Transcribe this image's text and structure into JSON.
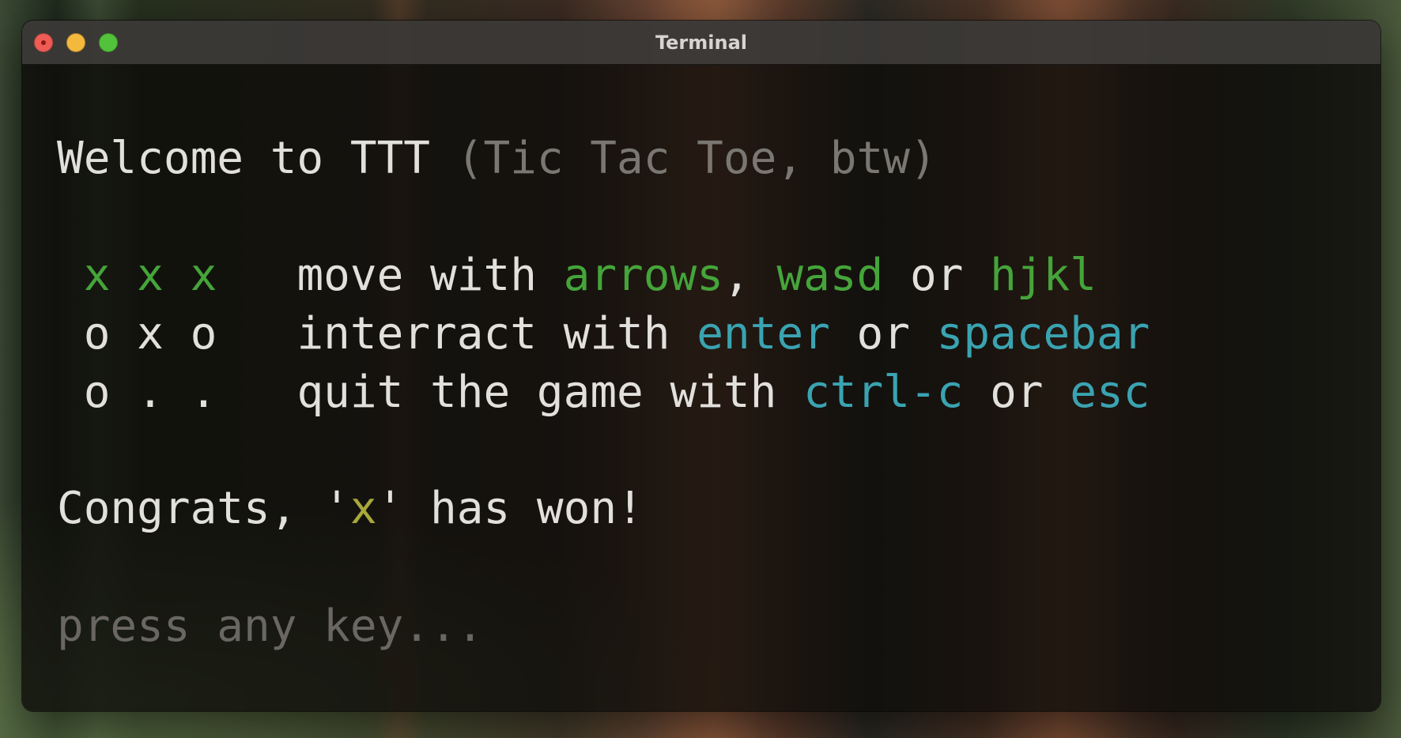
{
  "window": {
    "title": "Terminal"
  },
  "terminal": {
    "welcome": {
      "main": "Welcome to TTT",
      "aside": "(Tic Tac Toe, btw)"
    },
    "board": [
      [
        "x",
        "x",
        "x"
      ],
      [
        "o",
        "x",
        "o"
      ],
      [
        "o",
        ".",
        "."
      ]
    ],
    "help": {
      "move": {
        "prefix": "move with",
        "key1": "arrows",
        "sep1": ",",
        "key2": "wasd",
        "or": "or",
        "key3": "hjkl"
      },
      "interact": {
        "prefix": "interract with",
        "key1": "enter",
        "or": "or",
        "key2": "spacebar"
      },
      "quit": {
        "prefix": "quit the game with",
        "key1": "ctrl-c",
        "or": "or",
        "key2": "esc"
      }
    },
    "result": {
      "before": "Congrats, '",
      "winner": "x",
      "after": "' has won!"
    },
    "prompt": "press any key..."
  },
  "colors": {
    "text": "#e2e0dc",
    "dim": "#7a7772",
    "green": "#45a43a",
    "cyan": "#3aa3b1",
    "yellow": "#a9a83a"
  }
}
